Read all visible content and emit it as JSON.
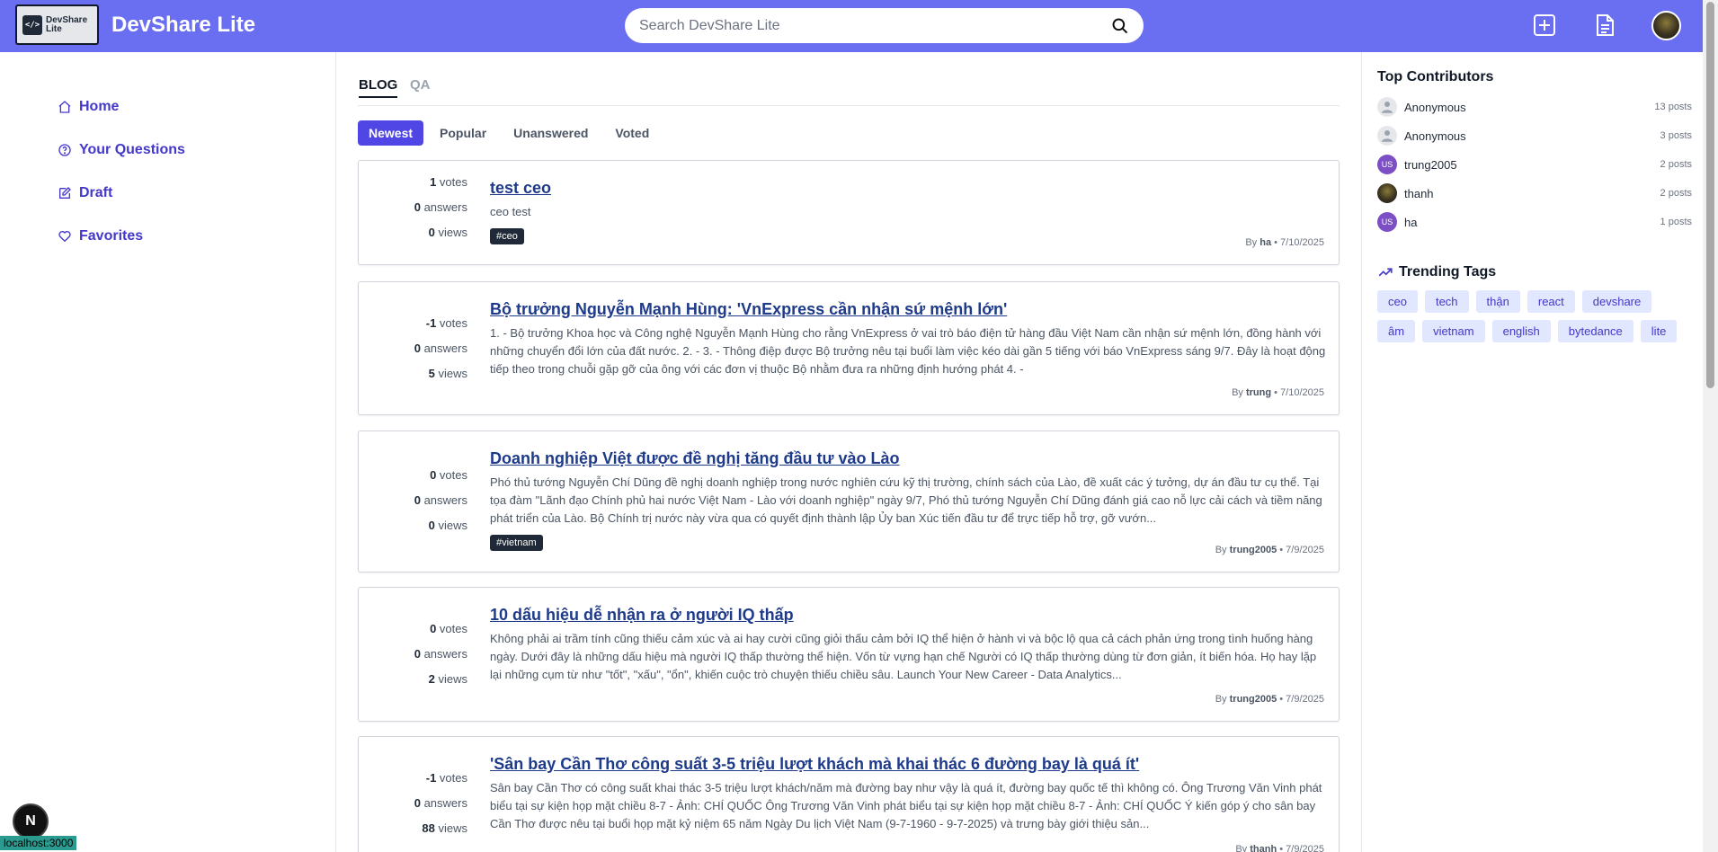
{
  "header": {
    "logo_text_line1": "DevShare",
    "logo_text_line2": "Lite",
    "logo_glyph": "</>",
    "app_title": "DevShare Lite",
    "search_placeholder": "Search DevShare Lite",
    "accent_color": "#6a6ef0"
  },
  "sidebar": {
    "items": [
      {
        "label": "Home",
        "icon": "home-icon"
      },
      {
        "label": "Your Questions",
        "icon": "question-circle-icon"
      },
      {
        "label": "Draft",
        "icon": "edit-icon"
      },
      {
        "label": "Favorites",
        "icon": "heart-icon"
      }
    ]
  },
  "main": {
    "tabs": [
      {
        "label": "BLOG"
      },
      {
        "label": "QA"
      }
    ],
    "filters": [
      {
        "label": "Newest"
      },
      {
        "label": "Popular"
      },
      {
        "label": "Unanswered"
      },
      {
        "label": "Voted"
      }
    ],
    "posts": [
      {
        "votes": "1",
        "answers": "0",
        "views": "0",
        "votes_label": "votes",
        "answers_label": "answers",
        "views_label": "views",
        "title": "test ceo",
        "excerpt": "ceo test",
        "tag": "#ceo",
        "author": "ha",
        "date": "7/10/2025"
      },
      {
        "votes": "-1",
        "answers": "0",
        "views": "5",
        "votes_label": "votes",
        "answers_label": "answers",
        "views_label": "views",
        "title": "Bộ trưởng Nguyễn Mạnh Hùng: 'VnExpress cần nhận sứ mệnh lớn'",
        "excerpt": "1. - Bộ trưởng Khoa học và Công nghệ Nguyễn Mạnh Hùng cho rằng VnExpress ở vai trò báo điện tử hàng đầu Việt Nam cần nhận sứ mệnh lớn, đồng hành với những chuyển đổi lớn của đất nước. 2. - 3. - Thông điệp được Bộ trưởng nêu tại buổi làm việc kéo dài gần 5 tiếng với báo VnExpress sáng 9/7. Đây là hoạt động tiếp theo trong chuỗi gặp gỡ của ông với các đơn vị thuộc Bộ nhằm đưa ra những định hướng phát 4. -",
        "tag": "",
        "author": "trung",
        "date": "7/10/2025"
      },
      {
        "votes": "0",
        "answers": "0",
        "views": "0",
        "votes_label": "votes",
        "answers_label": "answers",
        "views_label": "views",
        "title": "Doanh nghiệp Việt được đề nghị tăng đầu tư vào Lào",
        "excerpt": "Phó thủ tướng Nguyễn Chí Dũng đề nghị doanh nghiệp trong nước nghiên cứu kỹ thị trường, chính sách của Lào, đề xuất các ý tưởng, dự án đầu tư cụ thể. Tại tọa đàm \"Lãnh đạo Chính phủ hai nước Việt Nam - Lào với doanh nghiệp\" ngày 9/7, Phó thủ tướng Nguyễn Chí Dũng đánh giá cao nỗ lực cải cách và tiềm năng phát triển của Lào. Bộ Chính trị nước này vừa qua có quyết định thành lập Ủy ban Xúc tiến đầu tư để trực tiếp hỗ trợ, gỡ vướn...",
        "tag": "#vietnam",
        "author": "trung2005",
        "date": "7/9/2025"
      },
      {
        "votes": "0",
        "answers": "0",
        "views": "2",
        "votes_label": "votes",
        "answers_label": "answers",
        "views_label": "views",
        "title": "10 dấu hiệu dễ nhận ra ở người IQ thấp",
        "excerpt": "Không phải ai trầm tính cũng thiếu cảm xúc và ai hay cười cũng giỏi thấu cảm bởi IQ thể hiện ở hành vi và bộc lộ qua cả cách phản ứng trong tình huống hàng ngày. Dưới đây là những dấu hiệu mà người IQ thấp thường thể hiện. Vốn từ vựng hạn chế Người có IQ thấp thường dùng từ đơn giản, ít biến hóa. Họ hay lặp lại những cụm từ như \"tốt\", \"xấu\", \"ổn\", khiến cuộc trò chuyện thiếu chiều sâu. Launch Your New Career - Data Analytics...",
        "tag": "",
        "author": "trung2005",
        "date": "7/9/2025"
      },
      {
        "votes": "-1",
        "answers": "0",
        "views": "88",
        "votes_label": "votes",
        "answers_label": "answers",
        "views_label": "views",
        "title": "'Sân bay Cần Thơ công suất 3-5 triệu lượt khách mà khai thác 6 đường bay là quá ít'",
        "excerpt": "Sân bay Cần Thơ có công suất khai thác 3-5 triệu lượt khách/năm mà đường bay như vậy là quá ít, đường bay quốc tế thì không có. Ông Trương Văn Vinh phát biểu tại sự kiện họp mặt chiều 8-7 - Ảnh: CHÍ QUỐC Ông Trương Văn Vinh phát biểu tại sự kiện họp mặt chiều 8-7 - Ảnh: CHÍ QUỐC Ý kiến góp ý cho sân bay Cần Thơ được nêu tại buổi họp mặt kỷ niệm 65 năm Ngày Du lịch Việt Nam (9-7-1960 - 9-7-2025) và trưng bày giới thiệu sản...",
        "tag": "",
        "author": "thanh",
        "date": "7/9/2025"
      }
    ],
    "by_label": "By"
  },
  "right": {
    "contributors_title": "Top Contributors",
    "contributors": [
      {
        "name": "Anonymous",
        "posts": "13 posts",
        "avatar": "anon",
        "initials": ""
      },
      {
        "name": "Anonymous",
        "posts": "3 posts",
        "avatar": "anon",
        "initials": ""
      },
      {
        "name": "trung2005",
        "posts": "2 posts",
        "avatar": "us",
        "initials": "US"
      },
      {
        "name": "thanh",
        "posts": "2 posts",
        "avatar": "photo",
        "initials": ""
      },
      {
        "name": "ha",
        "posts": "1 posts",
        "avatar": "us",
        "initials": "US"
      }
    ],
    "trending_title": "Trending Tags",
    "tags": [
      "ceo",
      "tech",
      "thận",
      "react",
      "devshare",
      "âm",
      "vietnam",
      "english",
      "bytedance",
      "lite"
    ]
  },
  "footer": {
    "next_badge": "N",
    "status_url": "localhost:3000"
  }
}
